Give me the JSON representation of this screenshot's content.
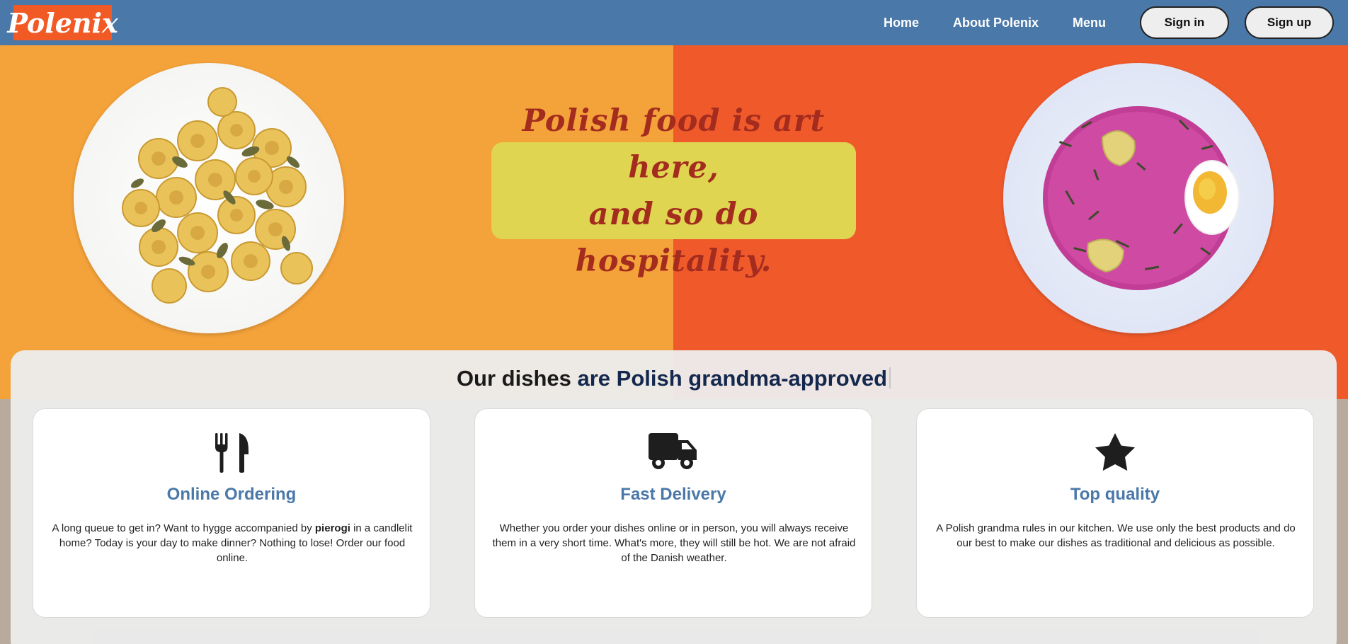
{
  "navbar": {
    "logo_text": "Polenix",
    "links": [
      "Home",
      "About Polenix",
      "Menu"
    ],
    "sign_in": "Sign in",
    "sign_up": "Sign up",
    "bg_color": "#4a78a8"
  },
  "hero": {
    "tagline_line1": "Polish food is art here,",
    "tagline_line2": "and so do hospitality.",
    "left_image": "plate of kopytka dumplings",
    "right_image": "bowl of chłodnik cold beet soup with egg"
  },
  "features": {
    "heading_prefix": "Our dishes",
    "heading_highlight": "are Polish grandma-approved",
    "cards": [
      {
        "icon": "utensils-icon",
        "title": "Online Ordering",
        "text_before": "A long queue to get in? Want to hygge accompanied by ",
        "text_bold": "pierogi",
        "text_after": " in a candlelit home? Today is your day to make dinner? Nothing to lose! Order our food online."
      },
      {
        "icon": "truck-icon",
        "title": "Fast Delivery",
        "text": "Whether you order your dishes online or in person, you will always receive them in a very short time. What's more, they will still be hot. We are not afraid of the Danish weather."
      },
      {
        "icon": "star-icon",
        "title": "Top quality",
        "text": "A Polish grandma rules in our kitchen. We use only the best products and do our best to make our dishes as traditional and delicious as possible."
      }
    ]
  },
  "colors": {
    "accent": "#4a78a8",
    "logo_bg": "#f15a24",
    "hero_left": "#f4a23a",
    "hero_right": "#f05a2b",
    "tagline_bg": "#dfd550",
    "tagline_text": "#a32c1f"
  }
}
